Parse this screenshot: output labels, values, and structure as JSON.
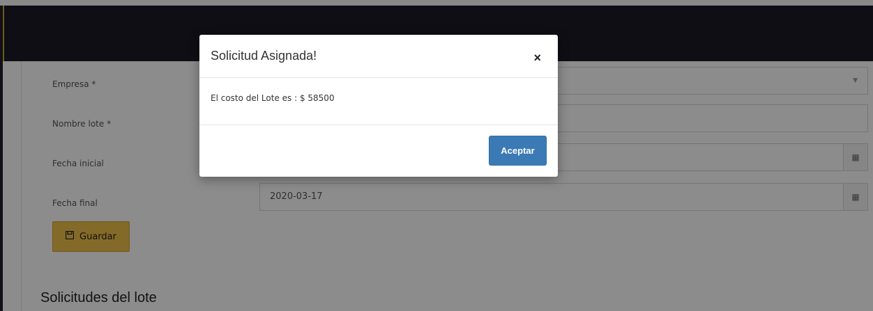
{
  "form": {
    "fields": [
      {
        "label": "Empresa *",
        "value": "",
        "type": "select"
      },
      {
        "label": "Nombre lote *",
        "value": "",
        "type": "text"
      },
      {
        "label": "Fecha inicial",
        "value": "",
        "type": "date"
      },
      {
        "label": "Fecha final",
        "value": "2020-03-17",
        "type": "date"
      }
    ],
    "save_label": "Guardar",
    "save_icon": "floppy-disk-icon"
  },
  "section_title": "Solicitudes del lote",
  "modal": {
    "title": "Solicitud Asignada!",
    "close_symbol": "×",
    "message": "El costo del Lote es : $ 58500",
    "accept_label": "Aceptar"
  },
  "colors": {
    "topbar": "#1b1a26",
    "save_button": "#f0c14b",
    "accept_button": "#3c7ab6"
  }
}
